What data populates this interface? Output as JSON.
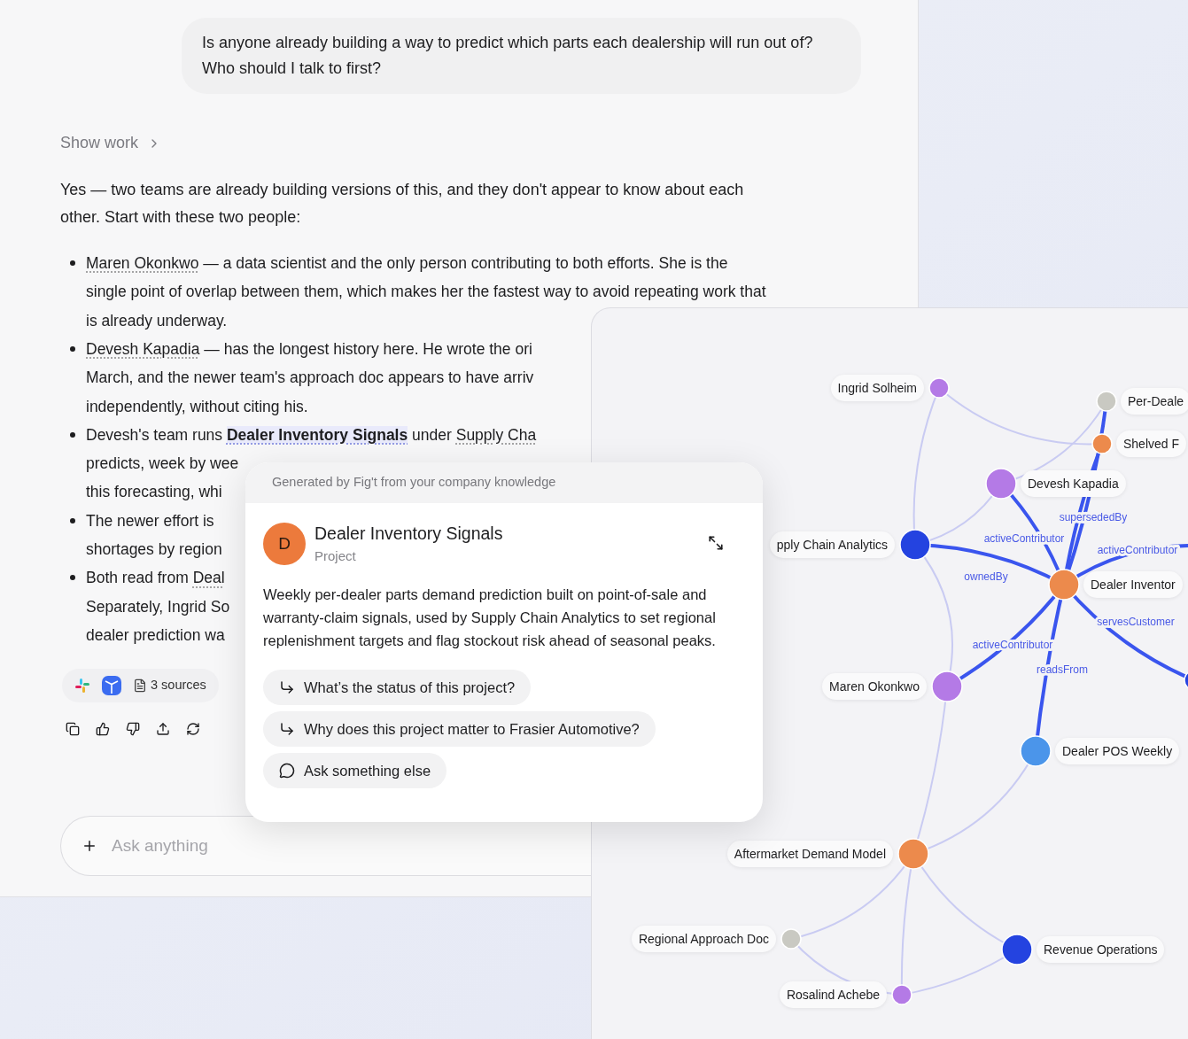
{
  "user_message": "Is anyone already building a way to predict which parts each dealership will run out of? Who should I talk to first?",
  "show_work": {
    "label": "Show work"
  },
  "answer_intro": "Yes — two teams are already building versions of this, and they don't appear to know about each other. Start with these two people:",
  "bullets": [
    {
      "lines": [
        [
          {
            "kind": "link",
            "text": "Maren Okonkwo"
          },
          {
            "kind": "text",
            "text": " — a data scientist and the only person contributing to both efforts. She is the"
          }
        ],
        [
          {
            "kind": "text",
            "text": "single point of overlap between them, which makes her the fastest way to avoid repeating work that"
          }
        ],
        [
          {
            "kind": "text",
            "text": "is already underway."
          }
        ]
      ]
    },
    {
      "lines": [
        [
          {
            "kind": "link",
            "text": "Devesh Kapadia"
          },
          {
            "kind": "text",
            "text": " — has the longest history here. He wrote the ori"
          }
        ],
        [
          {
            "kind": "text",
            "text": "March, and the newer team's approach doc appears to have arriv"
          }
        ],
        [
          {
            "kind": "text",
            "text": "independently, without citing his."
          }
        ]
      ]
    },
    {
      "lines": [
        [
          {
            "kind": "text",
            "text": "Devesh's team runs "
          },
          {
            "kind": "entity",
            "text": "Dealer Inventory Signals"
          },
          {
            "kind": "text",
            "text": " under "
          },
          {
            "kind": "link",
            "text": "Supply Cha"
          }
        ],
        [
          {
            "kind": "text",
            "text": "predicts, week by wee"
          }
        ],
        [
          {
            "kind": "text",
            "text": "this forecasting, whi"
          }
        ]
      ]
    },
    {
      "lines": [
        [
          {
            "kind": "text",
            "text": "The newer effort is"
          }
        ],
        [
          {
            "kind": "text",
            "text": "shortages by region"
          }
        ]
      ]
    },
    {
      "lines": [
        [
          {
            "kind": "text",
            "text": "Both read from "
          },
          {
            "kind": "link",
            "text": "Deal"
          }
        ],
        [
          {
            "kind": "text",
            "text": "Separately, Ingrid So"
          }
        ],
        [
          {
            "kind": "text",
            "text": "dealer prediction wa"
          }
        ]
      ]
    }
  ],
  "sources": {
    "label": "3 sources"
  },
  "composer": {
    "placeholder": "Ask anything"
  },
  "card": {
    "header": "Generated by Fig't from your company knowledge",
    "avatar": "D",
    "title": "Dealer Inventory Signals",
    "subtitle": "Project",
    "description": "Weekly per-dealer parts demand prediction built on point-of-sale and warranty-claim signals, used by Supply Chain Analytics to set regional replenishment targets and flag stockout risk ahead of seasonal peaks.",
    "suggestions": [
      {
        "kind": "followup",
        "text": "What’s the status of this project?"
      },
      {
        "kind": "followup",
        "text": "Why does this project matter to Frasier Automotive?"
      },
      {
        "kind": "ask",
        "text": "Ask something else"
      }
    ]
  },
  "graph": {
    "nodes": [
      {
        "label": "Ingrid Solheim",
        "color": "#b47ae6"
      },
      {
        "label": "Per-Deale",
        "color": "#c9c9c2"
      },
      {
        "label": "Shelved F",
        "color": "#ec8a4c"
      },
      {
        "label": "Devesh Kapadia",
        "color": "#b47ae6"
      },
      {
        "label": "pply Chain Analytics",
        "color": "#2443e0"
      },
      {
        "label": "Dealer Inventor",
        "color": "#ec8a4c"
      },
      {
        "label": "Maren Okonkwo",
        "color": "#b47ae6"
      },
      {
        "label": "Dealer POS Weekly",
        "color": "#4b95ea"
      },
      {
        "label": "Aftermarket Demand Model",
        "color": "#ec8a4c"
      },
      {
        "label": "Regional Approach Doc",
        "color": "#c9c9c2"
      },
      {
        "label": "Revenue Operations",
        "color": "#2443e0"
      },
      {
        "label": "Rosalind Achebe",
        "color": "#b47ae6"
      },
      {
        "color": "#2443e0"
      }
    ],
    "edges": [
      {
        "label": "activeContributor",
        "strong": true
      },
      {
        "label": "supersededBy",
        "strong": true
      },
      {
        "strong": true
      },
      {
        "label": "ownedBy",
        "strong": true
      },
      {
        "label": "activeContributor",
        "strong": true
      },
      {
        "label": "activeContributor",
        "strong": true
      },
      {
        "label": "readsFrom",
        "strong": true
      },
      {
        "label": "servesCustomer",
        "strong": true
      },
      {
        "strong": false
      },
      {
        "strong": false
      },
      {
        "strong": false
      },
      {
        "strong": false
      },
      {
        "strong": false
      },
      {
        "strong": false
      },
      {
        "strong": false
      },
      {
        "strong": false
      },
      {
        "strong": false
      },
      {
        "strong": false
      },
      {
        "strong": false
      },
      {
        "strong": false
      }
    ]
  }
}
